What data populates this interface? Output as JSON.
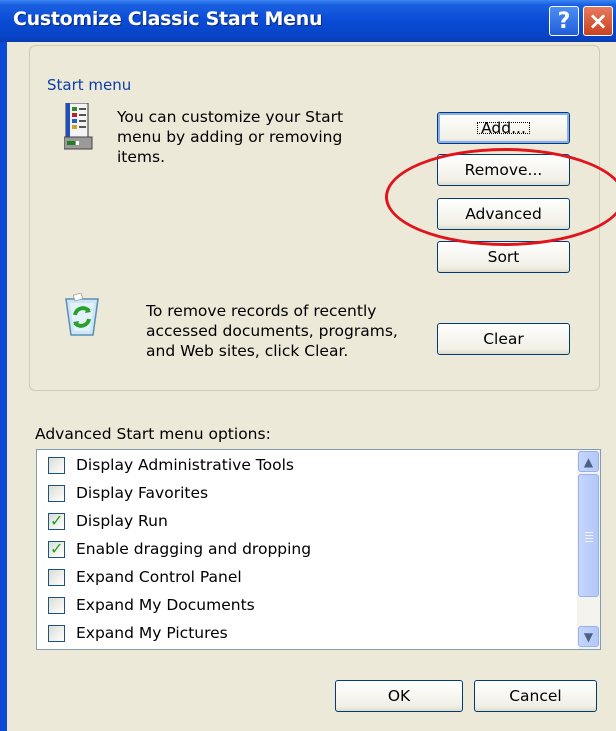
{
  "window": {
    "title": "Customize Classic Start Menu",
    "help_label": "?",
    "close_label": "×"
  },
  "start_menu": {
    "group_label": "Start menu",
    "description_lines": [
      "You can customize your Start",
      "menu by adding or removing",
      "items."
    ],
    "add_label": "Add...",
    "remove_label": "Remove...",
    "advanced_label": "Advanced",
    "sort_label": "Sort",
    "clear_description_lines": [
      "To remove records of recently",
      "accessed documents, programs,",
      "and Web sites, click Clear."
    ],
    "clear_label": "Clear"
  },
  "advanced": {
    "label": "Advanced Start menu options:",
    "options": [
      {
        "label": "Display Administrative Tools",
        "checked": false
      },
      {
        "label": "Display Favorites",
        "checked": false
      },
      {
        "label": "Display Run",
        "checked": true
      },
      {
        "label": "Enable dragging and dropping",
        "checked": true
      },
      {
        "label": "Expand Control Panel",
        "checked": false
      },
      {
        "label": "Expand My Documents",
        "checked": false
      },
      {
        "label": "Expand My Pictures",
        "checked": false
      }
    ]
  },
  "footer": {
    "ok_label": "OK",
    "cancel_label": "Cancel"
  },
  "colors": {
    "annotation_ellipse": "#e0141a",
    "title_bar": "#0a4bd6",
    "group_label": "#0b3ea8"
  },
  "icons": {
    "start_menu_icon": "start-menu-list-icon",
    "recycle_icon": "recycle-bin-icon",
    "scroll_up": "scroll-up-icon",
    "scroll_down": "scroll-down-icon"
  }
}
